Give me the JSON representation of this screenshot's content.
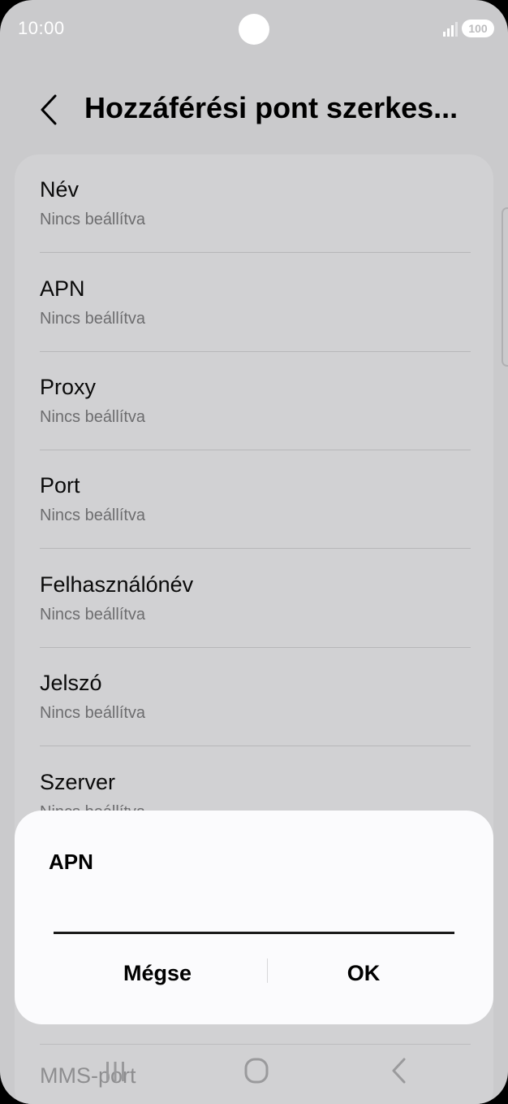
{
  "status_bar": {
    "time": "10:00",
    "battery": "100",
    "icons": [
      "signal-icon",
      "battery-icon",
      "camera-cutout"
    ]
  },
  "header": {
    "title": "Hozzáférési pont szerkes...",
    "back_icon": "chevron-left-icon"
  },
  "settings": {
    "rows": [
      {
        "title": "Név",
        "subtitle": "Nincs beállítva"
      },
      {
        "title": "APN",
        "subtitle": "Nincs beállítva"
      },
      {
        "title": "Proxy",
        "subtitle": "Nincs beállítva"
      },
      {
        "title": "Port",
        "subtitle": "Nincs beállítva"
      },
      {
        "title": "Felhasználónév",
        "subtitle": "Nincs beállítva"
      },
      {
        "title": "Jelszó",
        "subtitle": "Nincs beállítva"
      },
      {
        "title": "Szerver",
        "subtitle": "Nincs beállítva"
      }
    ],
    "peek_item": "MMS-port"
  },
  "dialog": {
    "title": "APN",
    "input_value": "",
    "cancel_label": "Mégse",
    "ok_label": "OK"
  },
  "nav_bar": {
    "icons": [
      "recents-icon",
      "home-icon",
      "back-icon"
    ]
  },
  "colors": {
    "dim_background": "#cacacc",
    "card": "#d1d1d3",
    "dialog": "#fbfbfd"
  }
}
